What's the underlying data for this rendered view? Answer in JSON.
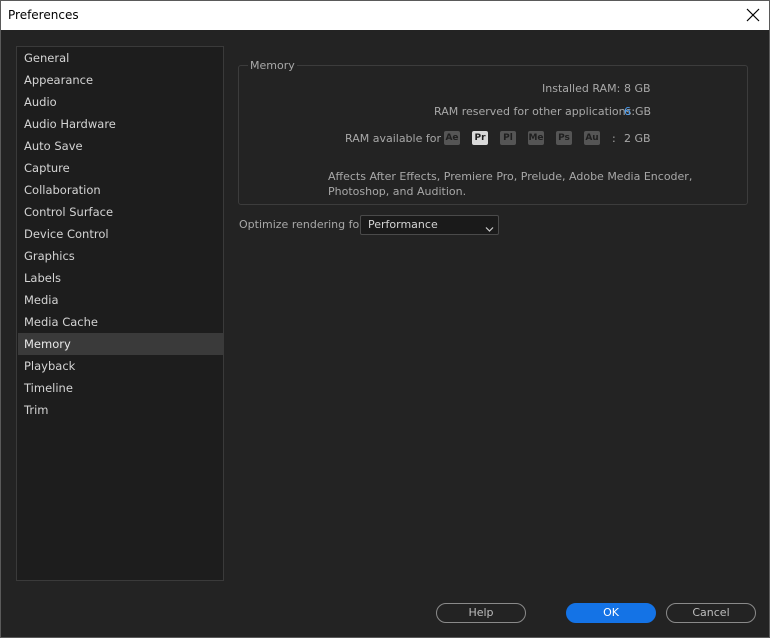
{
  "window": {
    "title": "Preferences"
  },
  "sidebar": {
    "items": [
      {
        "label": "General"
      },
      {
        "label": "Appearance"
      },
      {
        "label": "Audio"
      },
      {
        "label": "Audio Hardware"
      },
      {
        "label": "Auto Save"
      },
      {
        "label": "Capture"
      },
      {
        "label": "Collaboration"
      },
      {
        "label": "Control Surface"
      },
      {
        "label": "Device Control"
      },
      {
        "label": "Graphics"
      },
      {
        "label": "Labels"
      },
      {
        "label": "Media"
      },
      {
        "label": "Media Cache"
      },
      {
        "label": "Memory"
      },
      {
        "label": "Playback"
      },
      {
        "label": "Timeline"
      },
      {
        "label": "Trim"
      }
    ],
    "selected": "Memory"
  },
  "memory": {
    "group_title": "Memory",
    "installed_ram_label": "Installed RAM:",
    "installed_ram_value": "8 GB",
    "reserved_label": "RAM reserved for other applications:",
    "reserved_value": "6",
    "reserved_unit": "GB",
    "available_label": "RAM available for",
    "apps": [
      {
        "abbr": "Ae",
        "active": false
      },
      {
        "abbr": "Pr",
        "active": true
      },
      {
        "abbr": "Pl",
        "active": false
      },
      {
        "abbr": "Me",
        "active": false
      },
      {
        "abbr": "Ps",
        "active": false
      },
      {
        "abbr": "Au",
        "active": false
      }
    ],
    "available_sep": ":",
    "available_value": "2 GB",
    "note_line1": "Affects After Effects, Premiere Pro, Prelude, Adobe Media Encoder,",
    "note_line2": "Photoshop, and Audition."
  },
  "optimize": {
    "label": "Optimize rendering for:",
    "selected_value": "Performance"
  },
  "buttons": {
    "help": "Help",
    "ok": "OK",
    "cancel": "Cancel"
  },
  "colors": {
    "accent": "#1473e6",
    "value_highlight": "#4d9ef0",
    "background": "#232323"
  },
  "icons": {
    "close": "close-icon",
    "dropdown": "chevron-down-icon"
  }
}
